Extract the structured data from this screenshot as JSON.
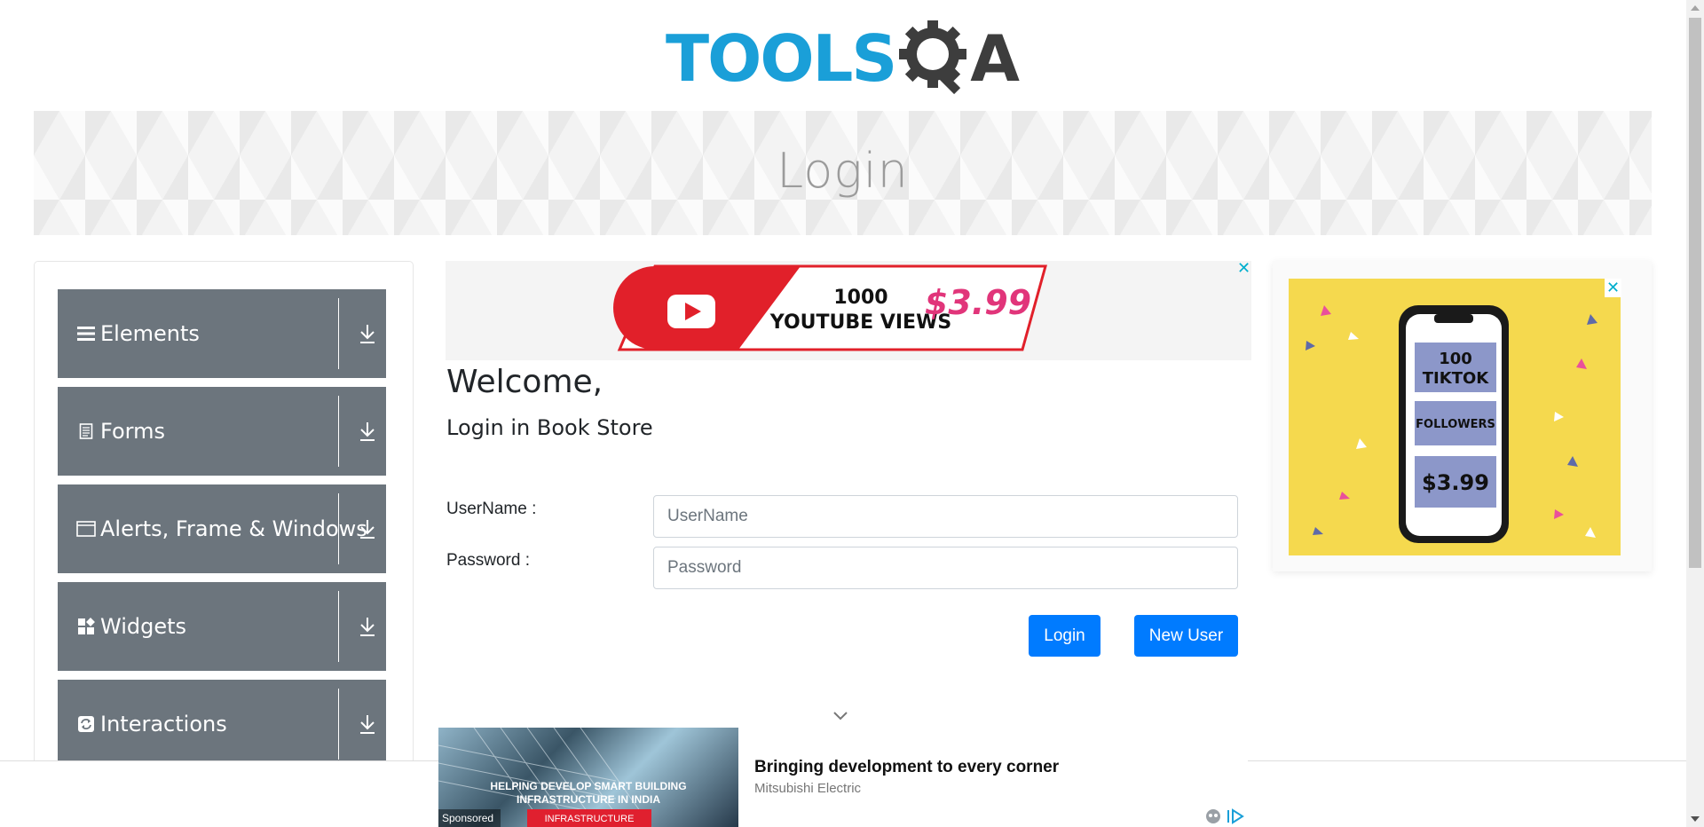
{
  "header": {
    "logo_tools": "TOOLS",
    "logo_a": "A",
    "brand_blue": "#1a9fd8",
    "brand_dark": "#3d3d3d"
  },
  "banner": {
    "title": "Login"
  },
  "sidebar": {
    "groups": [
      {
        "label": "Elements",
        "icon": "hamburger-icon"
      },
      {
        "label": "Forms",
        "icon": "document-icon"
      },
      {
        "label": "Alerts, Frame & Windows",
        "icon": "window-icon"
      },
      {
        "label": "Widgets",
        "icon": "widgets-icon"
      },
      {
        "label": "Interactions",
        "icon": "refresh-icon"
      }
    ],
    "group_bg": "#6c757d"
  },
  "ads": {
    "top": {
      "line1": "1000",
      "line2": "YOUTUBE VIEWS",
      "price": "$3.99",
      "close": "✕"
    },
    "right": {
      "line1": "100",
      "line2": "TIKTOK",
      "line3": "FOLLOWERS",
      "price": "$3.99",
      "close": "✕"
    },
    "bottom": {
      "headline": "Bringing development to every corner",
      "advertiser": "Mitsubishi Electric",
      "image_caption_line1": "HELPING DEVELOP SMART BUILDING",
      "image_caption_line2": "INFRASTRUCTURE IN INDIA",
      "image_tag": "INFRASTRUCTURE",
      "sponsored": "Sponsored"
    }
  },
  "login": {
    "welcome": "Welcome,",
    "subtitle": "Login in Book Store",
    "username_label": "UserName :",
    "username_placeholder": "UserName",
    "password_label": "Password :",
    "password_placeholder": "Password",
    "login_button": "Login",
    "new_user_button": "New User",
    "accent": "#007bff"
  }
}
